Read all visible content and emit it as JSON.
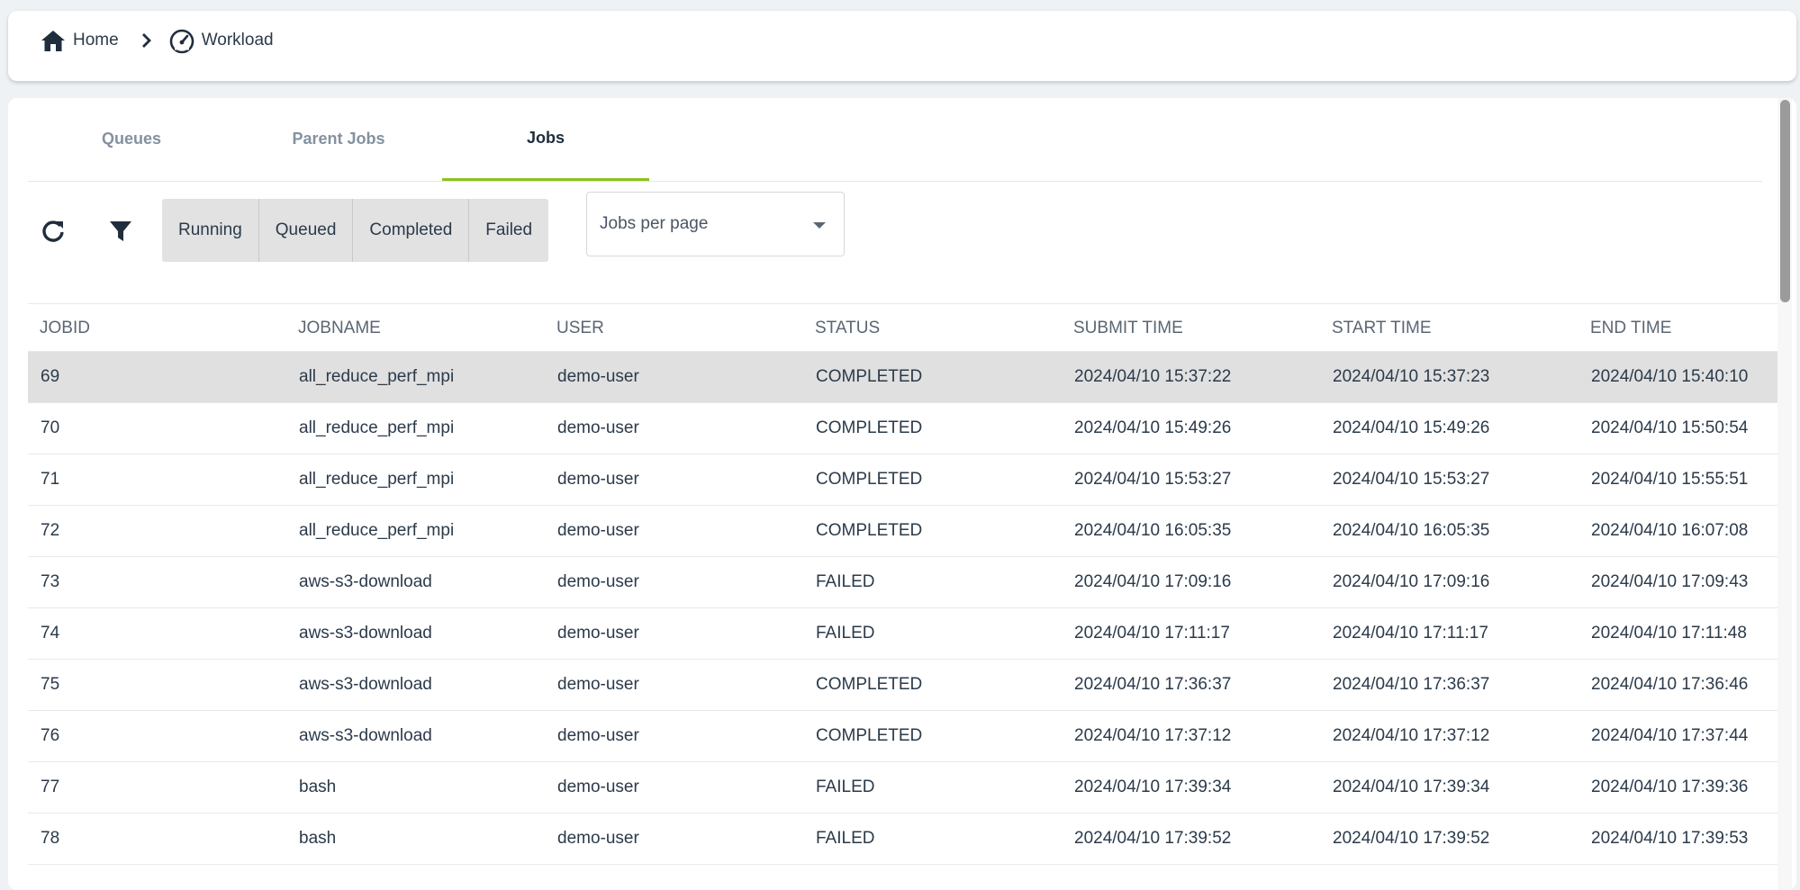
{
  "breadcrumb": {
    "home_label": "Home",
    "workload_label": "Workload"
  },
  "tabs": [
    {
      "label": "Queues",
      "active": false
    },
    {
      "label": "Parent Jobs",
      "active": false
    },
    {
      "label": "Jobs",
      "active": true
    }
  ],
  "toolbar": {
    "refresh_icon": "refresh-icon",
    "filter_icon": "filter-icon",
    "status_filters": [
      "Running",
      "Queued",
      "Completed",
      "Failed"
    ],
    "jobs_per_page_placeholder": "Jobs per page"
  },
  "colors": {
    "accent": "#8dc21f",
    "text": "#2b3a4a",
    "selected_row": "#e0e0e0"
  },
  "table": {
    "columns": [
      "JOBID",
      "JOBNAME",
      "USER",
      "STATUS",
      "SUBMIT TIME",
      "START TIME",
      "END TIME"
    ],
    "rows": [
      [
        "69",
        "all_reduce_perf_mpi",
        "demo-user",
        "COMPLETED",
        "2024/04/10 15:37:22",
        "2024/04/10 15:37:23",
        "2024/04/10 15:40:10"
      ],
      [
        "70",
        "all_reduce_perf_mpi",
        "demo-user",
        "COMPLETED",
        "2024/04/10 15:49:26",
        "2024/04/10 15:49:26",
        "2024/04/10 15:50:54"
      ],
      [
        "71",
        "all_reduce_perf_mpi",
        "demo-user",
        "COMPLETED",
        "2024/04/10 15:53:27",
        "2024/04/10 15:53:27",
        "2024/04/10 15:55:51"
      ],
      [
        "72",
        "all_reduce_perf_mpi",
        "demo-user",
        "COMPLETED",
        "2024/04/10 16:05:35",
        "2024/04/10 16:05:35",
        "2024/04/10 16:07:08"
      ],
      [
        "73",
        "aws-s3-download",
        "demo-user",
        "FAILED",
        "2024/04/10 17:09:16",
        "2024/04/10 17:09:16",
        "2024/04/10 17:09:43"
      ],
      [
        "74",
        "aws-s3-download",
        "demo-user",
        "FAILED",
        "2024/04/10 17:11:17",
        "2024/04/10 17:11:17",
        "2024/04/10 17:11:48"
      ],
      [
        "75",
        "aws-s3-download",
        "demo-user",
        "COMPLETED",
        "2024/04/10 17:36:37",
        "2024/04/10 17:36:37",
        "2024/04/10 17:36:46"
      ],
      [
        "76",
        "aws-s3-download",
        "demo-user",
        "COMPLETED",
        "2024/04/10 17:37:12",
        "2024/04/10 17:37:12",
        "2024/04/10 17:37:44"
      ],
      [
        "77",
        "bash",
        "demo-user",
        "FAILED",
        "2024/04/10 17:39:34",
        "2024/04/10 17:39:34",
        "2024/04/10 17:39:36"
      ],
      [
        "78",
        "bash",
        "demo-user",
        "FAILED",
        "2024/04/10 17:39:52",
        "2024/04/10 17:39:52",
        "2024/04/10 17:39:53"
      ]
    ],
    "selected_row_index": 0
  }
}
